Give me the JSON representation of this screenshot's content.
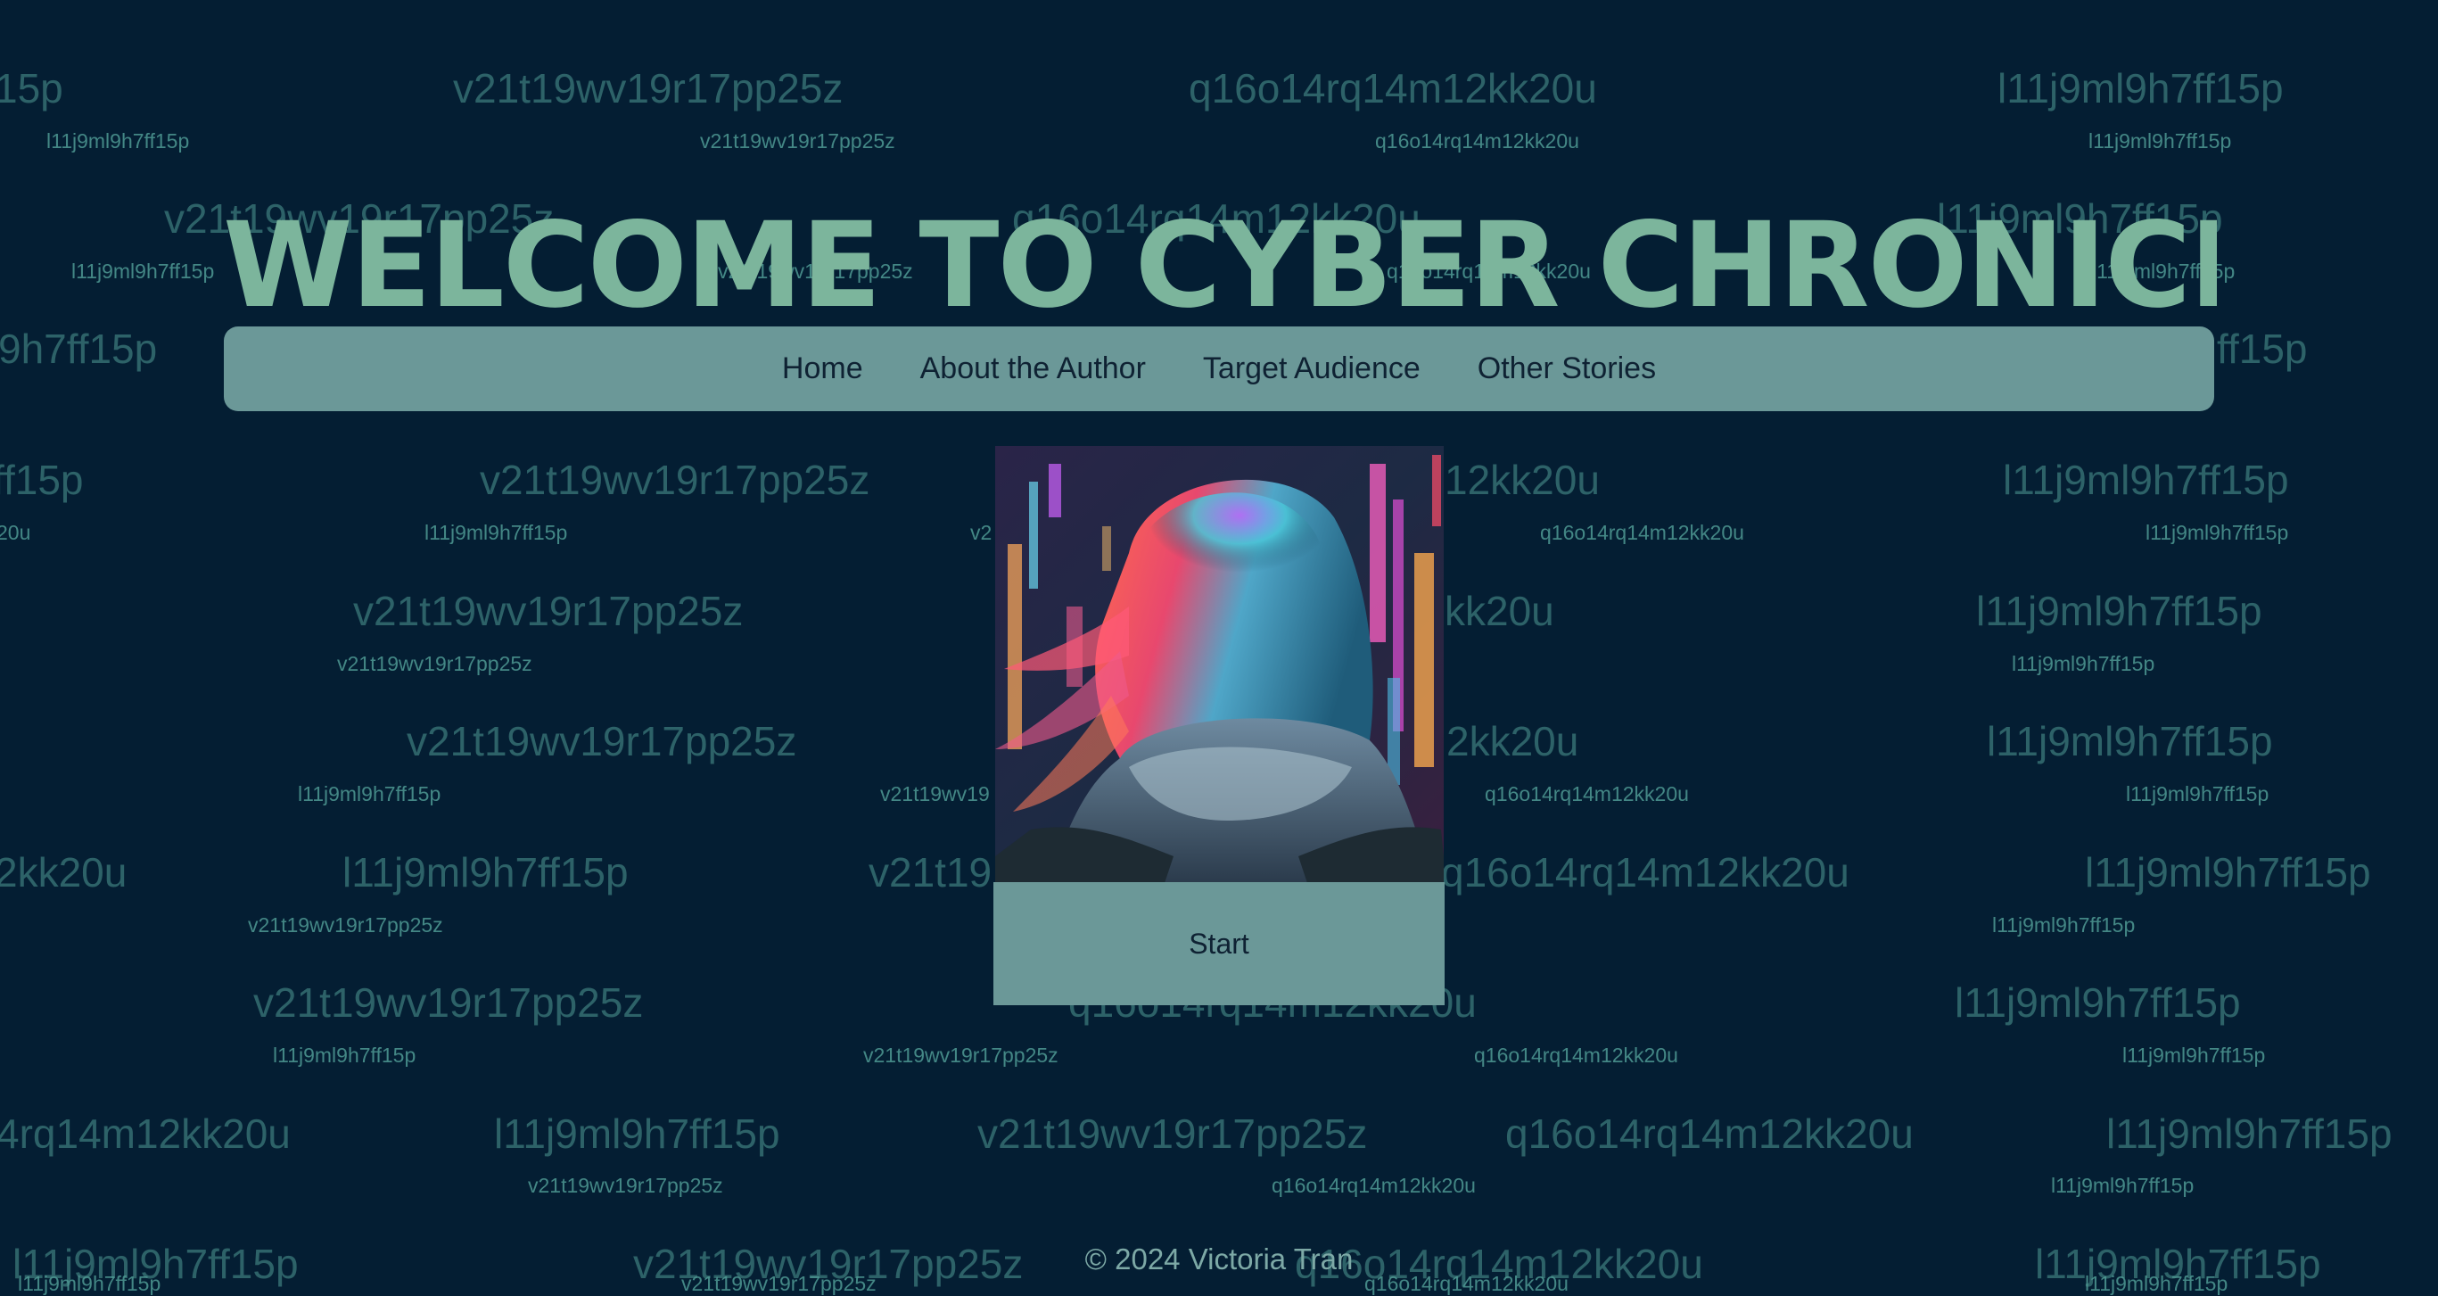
{
  "header": {
    "title": "WELCOME TO CYBER CHRONICLES!"
  },
  "nav": {
    "items": [
      {
        "label": "Home"
      },
      {
        "label": "About the Author"
      },
      {
        "label": "Target Audience"
      },
      {
        "label": "Other Stories"
      }
    ]
  },
  "main": {
    "image_alt": "Cyberpunk girl with neon-lit hair looking at a city",
    "start_label": "Start"
  },
  "footer": {
    "copyright": "© 2024 Victoria Tran"
  },
  "background": {
    "code_a": "v21t19wv19r17pp25z",
    "code_b": "q16o14rq14m12kk20u",
    "code_c": "l11j9ml9h7ff15p",
    "code_d": "9h7ff15p",
    "code_e": "ff15p",
    "code_f": "2kk20u",
    "code_g": "4rq14m12kk20u",
    "code_h": "15p",
    "code_i": "20u",
    "code_j": "12kk20u",
    "code_k": "kk20u",
    "code_l": "v2",
    "code_m": "v21t19wv19r17pp25z",
    "code_n": "v21t19",
    "code_o": "v21t19wv19"
  },
  "colors": {
    "page_background": "#041e33",
    "title_color": "#7cb59c",
    "nav_background": "#6b9898",
    "nav_text": "#0f2233",
    "background_code_text": "#356f72"
  }
}
